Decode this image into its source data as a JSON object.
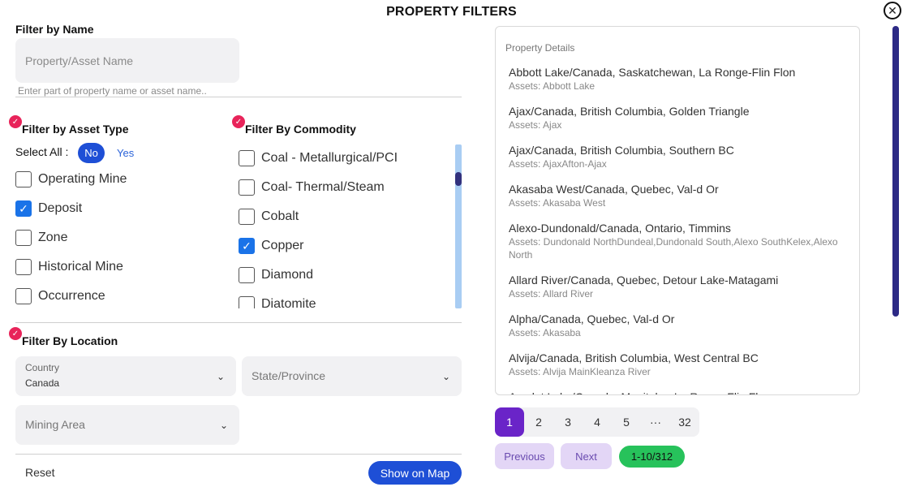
{
  "title": "PROPERTY FILTERS",
  "close_icon": "close-circle-icon",
  "name_filter": {
    "label": "Filter by Name",
    "placeholder": "Property/Asset Name",
    "helper": "Enter part of property name or asset name.."
  },
  "asset_type": {
    "label": "Filter by Asset Type",
    "select_all_label": "Select All :",
    "no_label": "No",
    "yes_label": "Yes",
    "items": [
      {
        "label": "Operating Mine",
        "checked": false
      },
      {
        "label": "Deposit",
        "checked": true
      },
      {
        "label": "Zone",
        "checked": false
      },
      {
        "label": "Historical Mine",
        "checked": false
      },
      {
        "label": "Occurrence",
        "checked": false
      }
    ]
  },
  "commodity": {
    "label": "Filter By Commodity",
    "items": [
      {
        "label": "Coal - Metallurgical/PCI",
        "checked": false
      },
      {
        "label": "Coal- Thermal/Steam",
        "checked": false
      },
      {
        "label": "Cobalt",
        "checked": false
      },
      {
        "label": "Copper",
        "checked": true
      },
      {
        "label": "Diamond",
        "checked": false
      },
      {
        "label": "Diatomite",
        "checked": false
      }
    ]
  },
  "location": {
    "label": "Filter By Location",
    "country_label": "Country",
    "country_value": "Canada",
    "state_placeholder": "State/Province",
    "mining_area_placeholder": "Mining Area"
  },
  "footer": {
    "reset": "Reset",
    "show_on_map": "Show on Map"
  },
  "results": {
    "header": "Property Details",
    "items": [
      {
        "name": "Abbott Lake/Canada, Saskatchewan, La Ronge-Flin Flon",
        "assets": "Assets: Abbott Lake"
      },
      {
        "name": "Ajax/Canada, British Columbia, Golden Triangle",
        "assets": "Assets: Ajax"
      },
      {
        "name": "Ajax/Canada, British Columbia, Southern BC",
        "assets": "Assets: AjaxAfton-Ajax"
      },
      {
        "name": "Akasaba West/Canada, Quebec, Val-d Or",
        "assets": "Assets: Akasaba West"
      },
      {
        "name": "Alexo-Dundonald/Canada, Ontario, Timmins",
        "assets": "Assets: Dundonald NorthDundeal,Dundonald South,Alexo SouthKelex,Alexo North"
      },
      {
        "name": "Allard River/Canada, Quebec, Detour Lake-Matagami",
        "assets": "Assets: Allard River"
      },
      {
        "name": "Alpha/Canada, Quebec, Val-d Or",
        "assets": "Assets: Akasaba"
      },
      {
        "name": "Alvija/Canada, British Columbia, West Central BC",
        "assets": "Assets: Alvija MainKleanza River"
      },
      {
        "name": "Amulet Lake/Canada, Manitoba, La Ronge-Flin Flon",
        "assets": ""
      }
    ]
  },
  "pagination": {
    "pages": [
      "1",
      "2",
      "3",
      "4",
      "5",
      "···",
      "32"
    ],
    "active": "1",
    "previous": "Previous",
    "next": "Next",
    "range": "1-10/312"
  },
  "colors": {
    "accent_blue": "#1e4fd6",
    "active_page": "#6a24c8",
    "badge_green": "#27c25b",
    "check_pink": "#e8245a"
  }
}
